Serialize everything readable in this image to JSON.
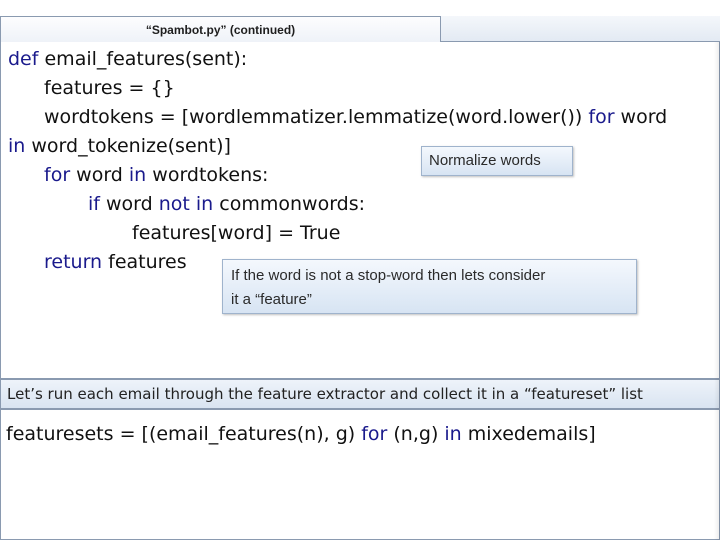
{
  "title": "“Spambot.py” (continued)",
  "code": {
    "l1_kw": "def",
    "l1_text": " email_features(sent):",
    "l2": "features = {}",
    "l3_text": "wordtokens = [wordlemmatizer.lemmatize(word.lower()) ",
    "l3_kw": "for",
    "l3_end": " word",
    "l4_kw": "in",
    "l4_text": " word_tokenize(sent)]",
    "l5_kw1": "for",
    "l5_mid": " word ",
    "l5_kw2": "in",
    "l5_end": " wordtokens:",
    "l6_kw1": "if",
    "l6_mid": " word ",
    "l6_kw2": "not in",
    "l6_end": " commonwords:",
    "l7": "features[word] =  True",
    "l8_kw": "return",
    "l8_text": " features"
  },
  "callouts": {
    "normalize": "Normalize words",
    "feature_line1": "If the word is not a stop-word then lets consider",
    "feature_line2": "it a “feature”"
  },
  "caption": "Let’s run each email through the feature extractor  and collect it in a “featureset” list",
  "bottom_code": {
    "text1": "featuresets = [(email_features(n), g) ",
    "kw1": "for",
    "text2": " (n,g) ",
    "kw2": "in",
    "text3": " mixedemails]"
  }
}
